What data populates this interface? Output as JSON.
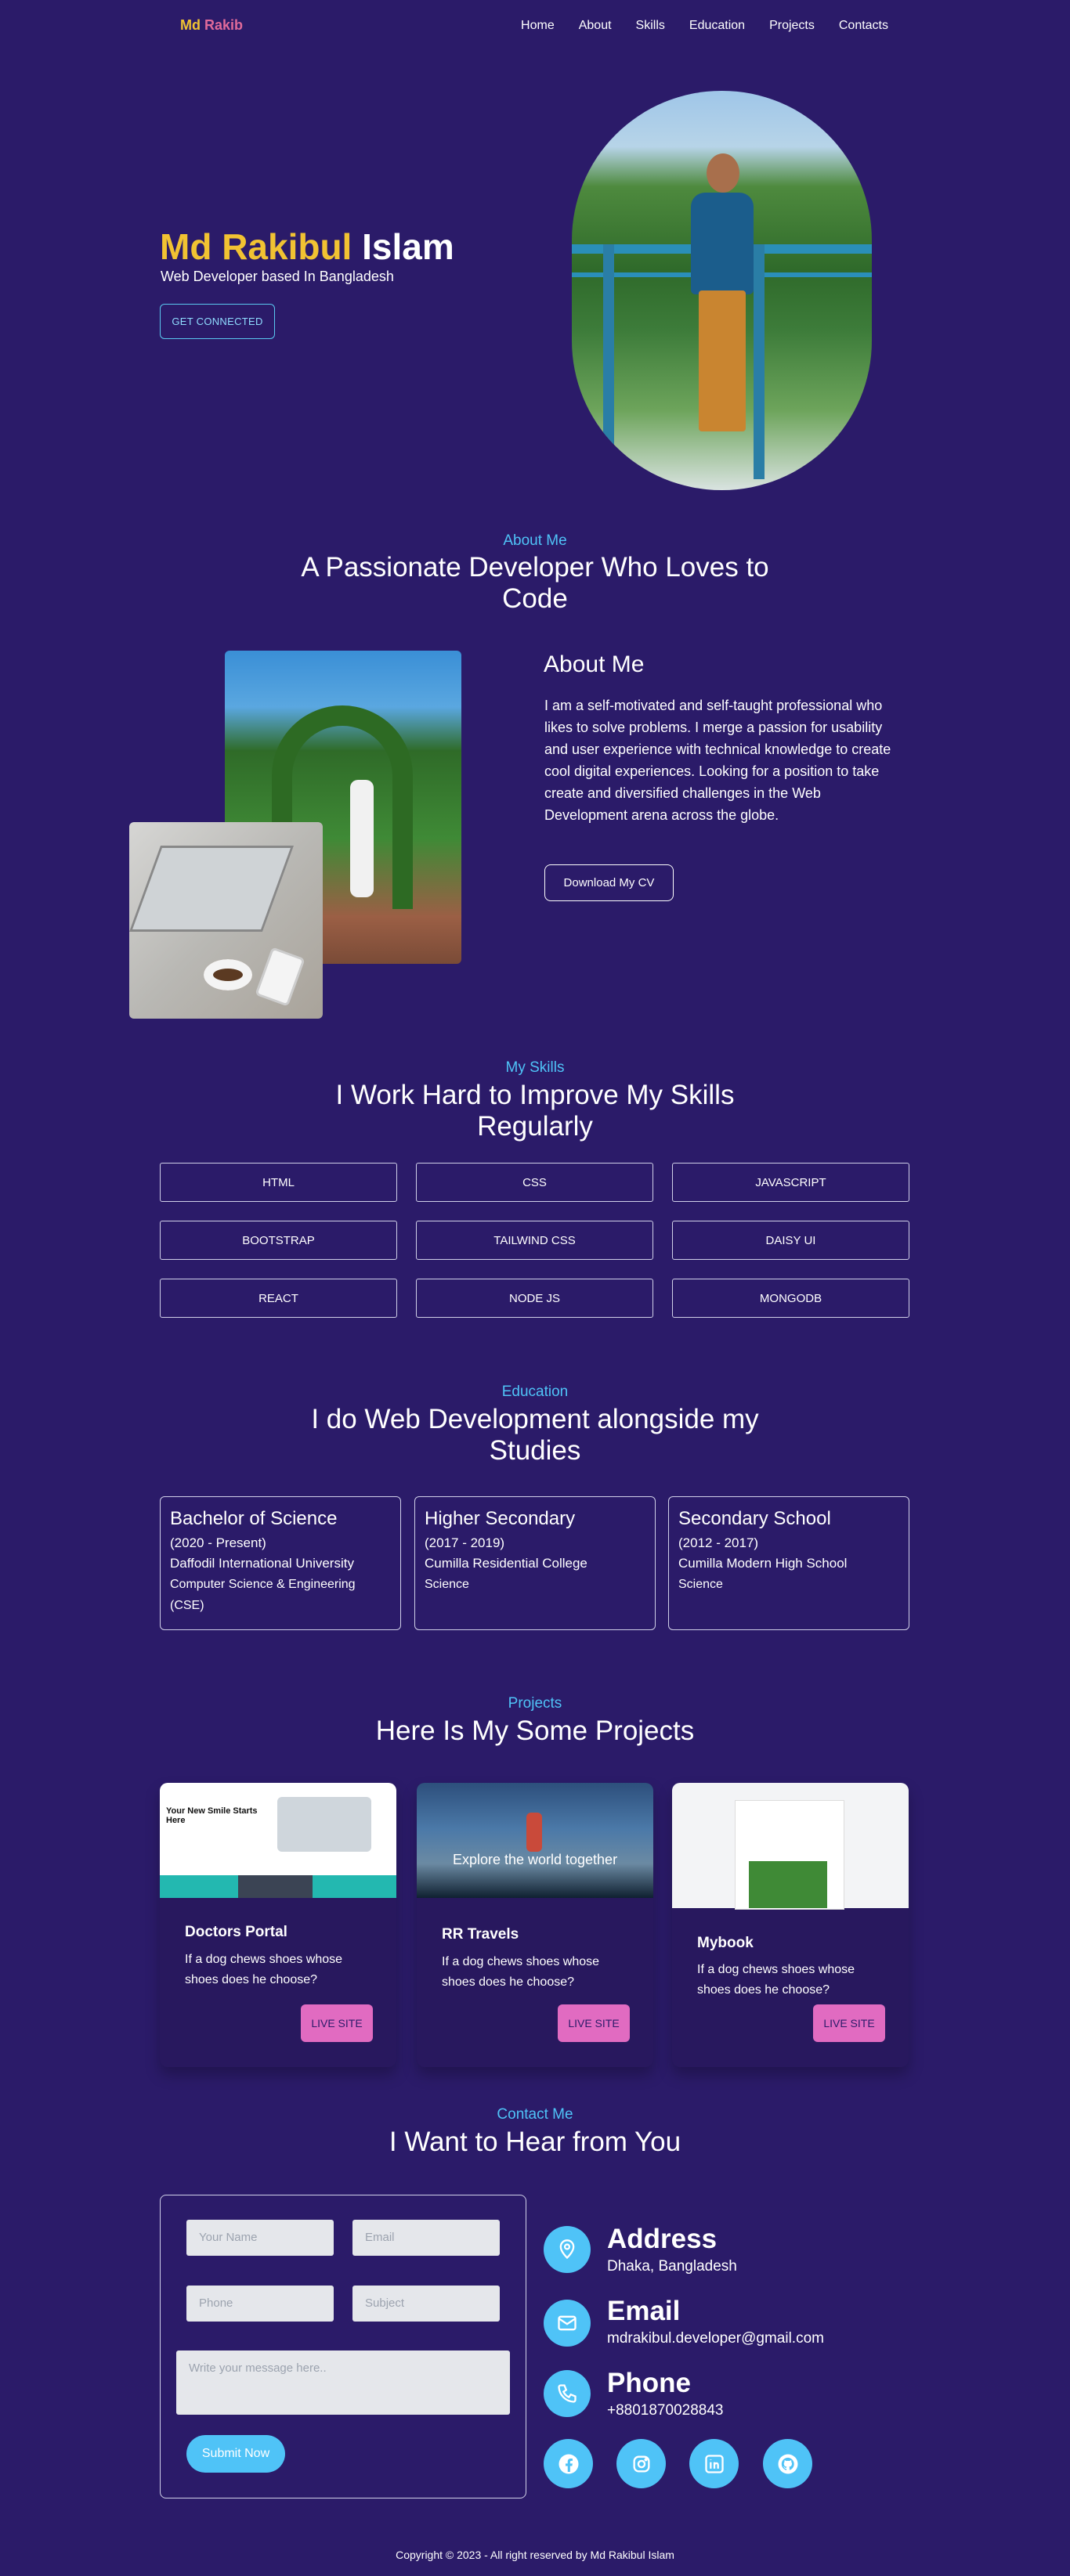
{
  "nav": {
    "logo_first": "Md",
    "logo_second": "Rakib",
    "links": [
      "Home",
      "About",
      "Skills",
      "Education",
      "Projects",
      "Contacts"
    ]
  },
  "hero": {
    "name_first": "Md Rakibul",
    "name_last": "Islam",
    "subtitle": "Web Developer based In Bangladesh",
    "button": "GET CONNECTED"
  },
  "about": {
    "eyebrow": "About Me",
    "heading": "A Passionate Developer Who Loves to Code",
    "title": "About Me",
    "text": "I am a self-motivated and self-taught professional who likes to solve problems. I merge a passion for usability and user experience with technical knowledge to create cool digital experiences. Looking for a position to take create and diversified challenges in the Web Development arena across the globe.",
    "button": "Download My CV"
  },
  "skills": {
    "eyebrow": "My Skills",
    "heading": "I Work Hard to Improve My Skills Regularly",
    "items": [
      "HTML",
      "CSS",
      "JAVASCRIPT",
      "BOOTSTRAP",
      "TAILWIND CSS",
      "DAISY UI",
      "REACT",
      "NODE JS",
      "MONGODB"
    ]
  },
  "education": {
    "eyebrow": "Education",
    "heading": "I do Web Development alongside my Studies",
    "items": [
      {
        "degree": "Bachelor of Science",
        "years": "(2020 - Present)",
        "institution": "Daffodil International University",
        "department": "Computer Science & Engineering (CSE)"
      },
      {
        "degree": "Higher Secondary",
        "years": "(2017 - 2019)",
        "institution": "Cumilla Residential College",
        "department": "Science"
      },
      {
        "degree": "Secondary School",
        "years": "(2012 - 2017)",
        "institution": "Cumilla Modern High School",
        "department": "Science"
      }
    ]
  },
  "projects": {
    "eyebrow": "Projects",
    "heading": "Here Is My Some Projects",
    "items": [
      {
        "title": "Doctors Portal",
        "desc": "If a dog chews shoes whose shoes does he choose?",
        "button": "LIVE SITE",
        "shot_heading": "Your New Smile Starts Here"
      },
      {
        "title": "RR Travels",
        "desc": "If a dog chews shoes whose shoes does he choose?",
        "button": "LIVE SITE",
        "shot_heading": "Explore the world together"
      },
      {
        "title": "Mybook",
        "desc": "If a dog chews shoes whose shoes does he choose?",
        "button": "LIVE SITE"
      }
    ]
  },
  "contact": {
    "eyebrow": "Contact Me",
    "heading": "I Want to Hear from You",
    "form": {
      "name_placeholder": "Your Name",
      "email_placeholder": "Email",
      "phone_placeholder": "Phone",
      "subject_placeholder": "Subject",
      "message_placeholder": "Write your message here..",
      "submit": "Submit Now"
    },
    "address_title": "Address",
    "address_value": "Dhaka, Bangladesh",
    "email_title": "Email",
    "email_value": "mdrakibul.developer@gmail.com",
    "phone_title": "Phone",
    "phone_value": "+8801870028843",
    "social_icons": [
      "facebook-icon",
      "instagram-icon",
      "linkedin-icon",
      "github-icon"
    ]
  },
  "footer": {
    "text": "Copyright © 2023 - All right reserved by Md Rakibul Islam"
  },
  "colors": {
    "background": "#2b1b69",
    "accent": "#4fc3f7",
    "name_highlight": "#f1c232",
    "live_button": "#e16bc1"
  }
}
